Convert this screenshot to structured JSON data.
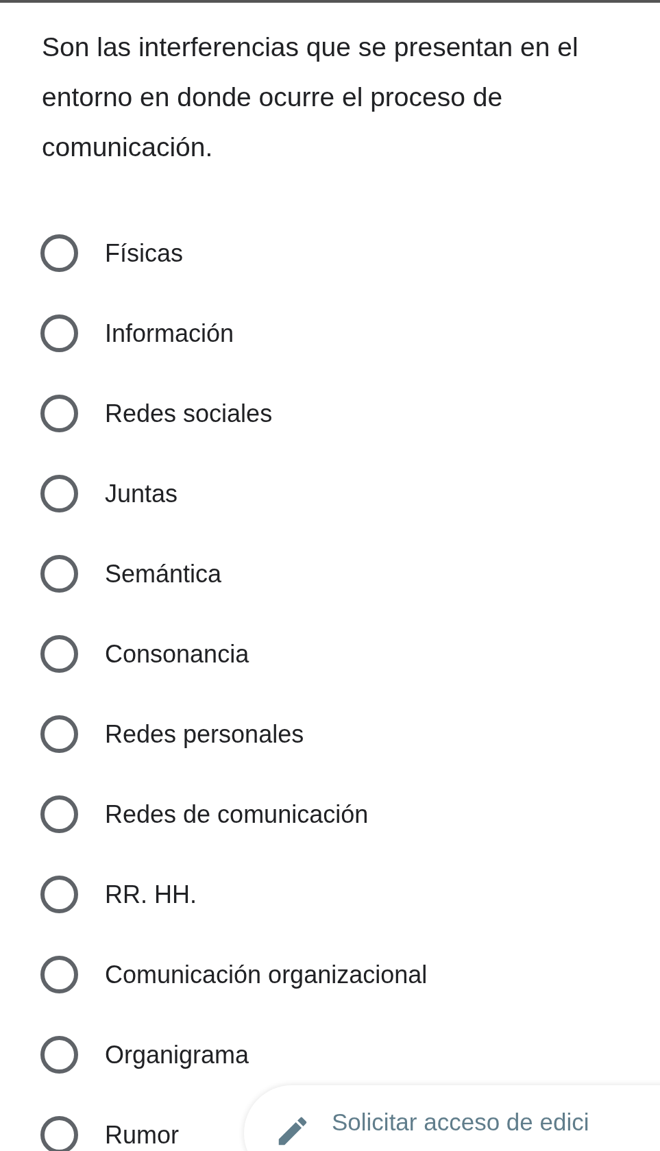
{
  "question": {
    "text": "Son las interferencias que se presentan en el entorno en donde ocurre el proceso de comunicación."
  },
  "options": [
    {
      "label": "Físicas",
      "selected": false
    },
    {
      "label": "Información",
      "selected": false
    },
    {
      "label": "Redes sociales",
      "selected": false
    },
    {
      "label": "Juntas",
      "selected": false
    },
    {
      "label": "Semántica",
      "selected": false
    },
    {
      "label": "Consonancia",
      "selected": false
    },
    {
      "label": "Redes personales",
      "selected": false
    },
    {
      "label": "Redes de comunicación",
      "selected": false
    },
    {
      "label": "RR. HH.",
      "selected": false
    },
    {
      "label": "Comunicación organizacional",
      "selected": false
    },
    {
      "label": "Organigrama",
      "selected": false
    },
    {
      "label": "Rumor",
      "selected": false
    }
  ],
  "edit_access_button": {
    "label": "Solicitar acceso de edici"
  }
}
